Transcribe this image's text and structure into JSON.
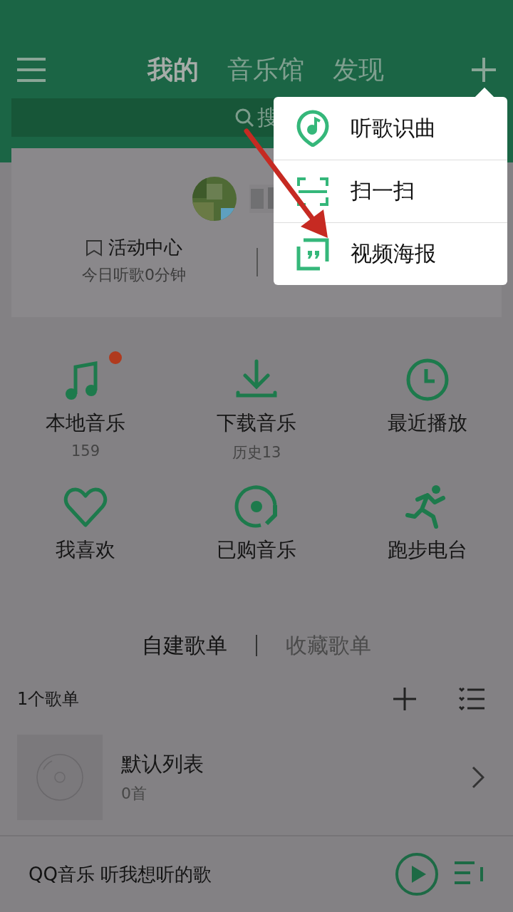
{
  "header": {
    "tabs": [
      {
        "label": "我的",
        "selected": true
      },
      {
        "label": "音乐馆",
        "selected": false
      },
      {
        "label": "发现",
        "selected": false
      }
    ]
  },
  "search": {
    "text": "搜"
  },
  "profile": {
    "activity": {
      "title": "活动中心",
      "subtitle": "今日听歌0分钟"
    }
  },
  "popup_menu": {
    "items": [
      {
        "kind": "recognize",
        "label": "听歌识曲"
      },
      {
        "kind": "scan",
        "label": "扫一扫"
      },
      {
        "kind": "poster",
        "label": "视频海报"
      }
    ]
  },
  "shortcuts": [
    {
      "kind": "note",
      "label": "本地音乐",
      "sub": "159",
      "badge": true
    },
    {
      "kind": "download",
      "label": "下载音乐",
      "sub": "历史13",
      "badge": false
    },
    {
      "kind": "clock",
      "label": "最近播放",
      "badge": false
    },
    {
      "kind": "heart",
      "label": "我喜欢",
      "badge": false
    },
    {
      "kind": "disc",
      "label": "已购音乐",
      "badge": false
    },
    {
      "kind": "run",
      "label": "跑步电台",
      "badge": false
    }
  ],
  "playlist_tabs": [
    {
      "label": "自建歌单",
      "selected": true
    },
    {
      "label": "收藏歌单",
      "selected": false
    }
  ],
  "playlists": {
    "count": "1个歌单",
    "items": [
      {
        "title": "默认列表",
        "songs": "0首"
      }
    ]
  },
  "player": {
    "text": "QQ音乐 听我想听的歌"
  }
}
